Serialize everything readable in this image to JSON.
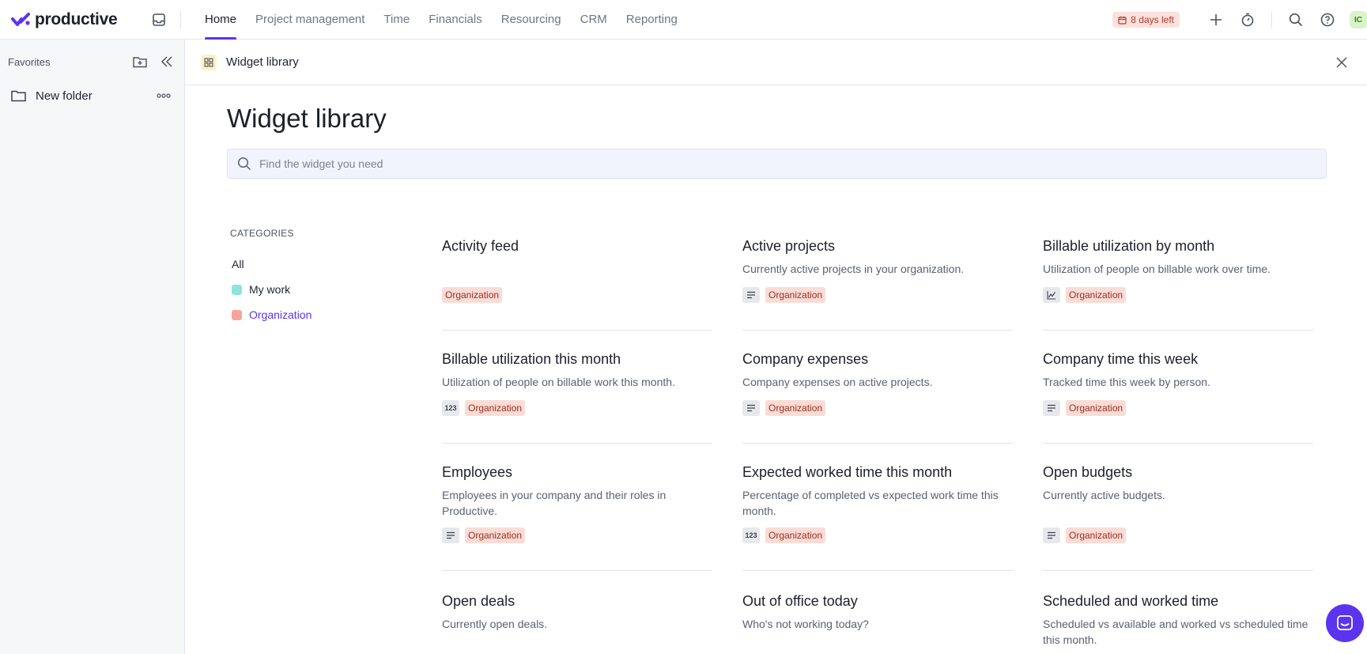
{
  "app": {
    "name": "productive"
  },
  "nav": {
    "items": [
      {
        "label": "Home",
        "active": true
      },
      {
        "label": "Project management"
      },
      {
        "label": "Time"
      },
      {
        "label": "Financials"
      },
      {
        "label": "Resourcing"
      },
      {
        "label": "CRM"
      },
      {
        "label": "Reporting"
      }
    ]
  },
  "topright": {
    "trial": "8 days left",
    "avatar": "IC"
  },
  "sidebar": {
    "favorites_title": "Favorites",
    "folders": [
      {
        "label": "New folder"
      }
    ]
  },
  "panel": {
    "header_title": "Widget library",
    "page_title": "Widget library",
    "search_placeholder": "Find the widget you need"
  },
  "categories": {
    "heading": "CATEGORIES",
    "items": [
      {
        "label": "All"
      },
      {
        "label": "My work",
        "color": "#8fe4dc"
      },
      {
        "label": "Organization",
        "color": "#f7a59b",
        "selected": true
      }
    ]
  },
  "widgets": [
    {
      "title": "Activity feed",
      "desc": "",
      "type_icon": "",
      "tag": "Organization"
    },
    {
      "title": "Active projects",
      "desc": "Currently active projects in your organization.",
      "type_icon": "list-icon",
      "tag": "Organization"
    },
    {
      "title": "Billable utilization by month",
      "desc": "Utilization of people on billable work over time.",
      "type_icon": "line-chart-icon",
      "tag": "Organization"
    },
    {
      "title": "Billable utilization this month",
      "desc": "Utilization of people on billable work this month.",
      "type_icon": "number-icon",
      "type_text": "123",
      "tag": "Organization"
    },
    {
      "title": "Company expenses",
      "desc": "Company expenses on active projects.",
      "type_icon": "list-icon",
      "tag": "Organization"
    },
    {
      "title": "Company time this week",
      "desc": "Tracked time this week by person.",
      "type_icon": "list-icon",
      "tag": "Organization"
    },
    {
      "title": "Employees",
      "desc": "Employees in your company and their roles in Productive.",
      "type_icon": "list-icon",
      "tag": "Organization"
    },
    {
      "title": "Expected worked time this month",
      "desc": "Percentage of completed vs expected work time this month.",
      "type_icon": "number-icon",
      "type_text": "123",
      "tag": "Organization"
    },
    {
      "title": "Open budgets",
      "desc": "Currently active budgets.",
      "type_icon": "list-icon",
      "tag": "Organization"
    },
    {
      "title": "Open deals",
      "desc": "Currently open deals.",
      "type_icon": "",
      "tag": ""
    },
    {
      "title": "Out of office today",
      "desc": "Who's not working today?",
      "type_icon": "",
      "tag": ""
    },
    {
      "title": "Scheduled and worked time",
      "desc": "Scheduled vs available and worked vs scheduled time this month.",
      "type_icon": "",
      "tag": ""
    }
  ],
  "colors": {
    "accent": "#5b34f0",
    "org_tag_bg": "#fadcd6",
    "trial_bg": "#fde1dc"
  }
}
